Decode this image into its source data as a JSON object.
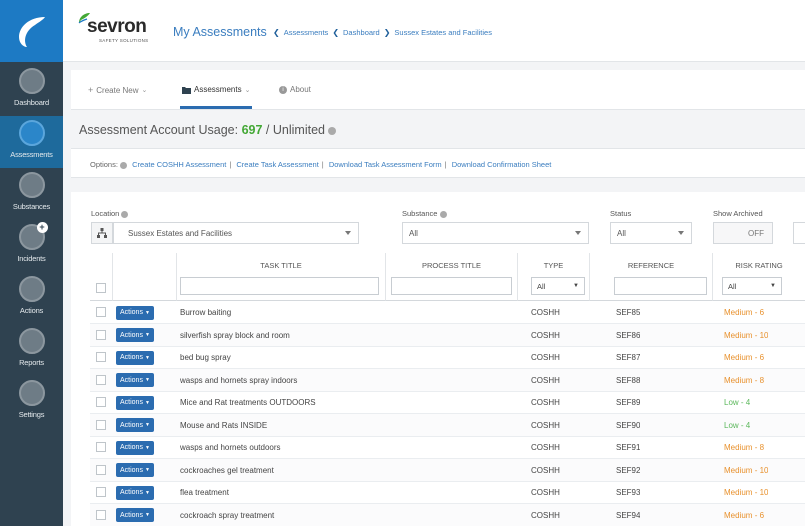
{
  "colors": {
    "sidebar": "#2f4250",
    "brand_blue": "#1d7ac4",
    "link": "#3a7dbf",
    "usage_green": "#43a835",
    "risk_medium": "#e8912d",
    "risk_low": "#5cb85c",
    "action_btn": "#2b6cb0"
  },
  "sidebar": {
    "items": [
      {
        "label": "Dashboard",
        "icon": "dashboard-icon",
        "active": false
      },
      {
        "label": "Assessments",
        "icon": "assessments-icon",
        "active": true
      },
      {
        "label": "Substances",
        "icon": "substances-icon",
        "active": false
      },
      {
        "label": "Incidents",
        "icon": "incidents-icon",
        "active": false
      },
      {
        "label": "Actions",
        "icon": "actions-icon",
        "active": false
      },
      {
        "label": "Reports",
        "icon": "reports-icon",
        "active": false
      },
      {
        "label": "Settings",
        "icon": "settings-icon",
        "active": false
      }
    ]
  },
  "header": {
    "brand": "sevron",
    "brand_sub": "SAFETY SOLUTIONS",
    "title": "My Assessments",
    "breadcrumb": [
      "Assessments",
      "Dashboard",
      "Sussex Estates and Facilities"
    ]
  },
  "tabs": [
    {
      "label": "Create New",
      "icon": "plus-icon"
    },
    {
      "label": "Assessments",
      "icon": "folder-icon"
    },
    {
      "label": "About",
      "icon": "info-icon"
    }
  ],
  "usage": {
    "label": "Assessment Account Usage:",
    "used": "697",
    "sep": " / ",
    "limit": "Unlimited"
  },
  "options": {
    "label": "Options:",
    "links": [
      "Create COSHH Assessment",
      "Create Task Assessment",
      "Download Task Assessment Form",
      "Download Confirmation Sheet"
    ]
  },
  "filters": {
    "location_label": "Location",
    "location_value": "Sussex Estates and Facilities",
    "substance_label": "Substance",
    "substance_value": "All",
    "status_label": "Status",
    "status_value": "All",
    "archived_label": "Show Archived",
    "archived_value": "OFF"
  },
  "table": {
    "headers": {
      "task": "TASK TITLE",
      "process": "PROCESS TITLE",
      "type": "TYPE",
      "reference": "REFERENCE",
      "risk": "RISK RATING"
    },
    "type_filter": "All",
    "risk_filter": "All",
    "actions_label": "Actions",
    "rows": [
      {
        "task": "Burrow baiting",
        "type": "COSHH",
        "ref": "SEF85",
        "risk_level": "Medium",
        "risk_score": "- 6"
      },
      {
        "task": "silverfish spray block and room",
        "type": "COSHH",
        "ref": "SEF86",
        "risk_level": "Medium",
        "risk_score": "- 10"
      },
      {
        "task": "bed bug spray",
        "type": "COSHH",
        "ref": "SEF87",
        "risk_level": "Medium",
        "risk_score": "- 6"
      },
      {
        "task": "wasps and hornets spray indoors",
        "type": "COSHH",
        "ref": "SEF88",
        "risk_level": "Medium",
        "risk_score": "- 8"
      },
      {
        "task": "Mice and Rat treatments OUTDOORS",
        "type": "COSHH",
        "ref": "SEF89",
        "risk_level": "Low",
        "risk_score": "- 4"
      },
      {
        "task": "Mouse and Rats INSIDE",
        "type": "COSHH",
        "ref": "SEF90",
        "risk_level": "Low",
        "risk_score": "- 4"
      },
      {
        "task": "wasps and hornets outdoors",
        "type": "COSHH",
        "ref": "SEF91",
        "risk_level": "Medium",
        "risk_score": "- 8"
      },
      {
        "task": "cockroaches gel treatment",
        "type": "COSHH",
        "ref": "SEF92",
        "risk_level": "Medium",
        "risk_score": "- 10"
      },
      {
        "task": "flea treatment",
        "type": "COSHH",
        "ref": "SEF93",
        "risk_level": "Medium",
        "risk_score": "- 10"
      },
      {
        "task": "cockroach spray treatment",
        "type": "COSHH",
        "ref": "SEF94",
        "risk_level": "Medium",
        "risk_score": "- 6"
      }
    ]
  }
}
